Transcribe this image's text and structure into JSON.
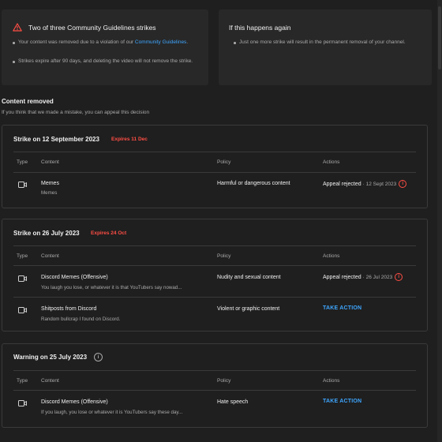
{
  "summary": {
    "title": "Two of three Community Guidelines strikes",
    "bullet1_text": "Your content was removed due to a violation of our",
    "bullet1_link": "Community Guidelines",
    "bullet1_end": ".",
    "bullet2": "Strikes expire after 90 days, and deleting the video will not remove the strike."
  },
  "again": {
    "title": "If this happens again",
    "bullet": "Just one more strike will result in the permanent removal of your channel."
  },
  "section": {
    "title": "Content removed",
    "subtitle": "If you think that we made a mistake, you can appeal this decision"
  },
  "headers": {
    "type": "Type",
    "content": "Content",
    "policy": "Policy",
    "actions": "Actions"
  },
  "strikes": [
    {
      "title": "Strike on 12 September 2023",
      "expires": "Expires 11 Dec",
      "rows": [
        {
          "title": "Memes",
          "desc": "Memes",
          "policy": "Harmful or dangerous content",
          "status": "Appeal rejected",
          "date": "· 12 Sept 2023"
        }
      ]
    },
    {
      "title": "Strike on 26 July 2023",
      "expires": "Expires 24 Oct",
      "rows": [
        {
          "title": "Discord Memes (Offensive)",
          "desc": "You laugh you lose, or whatever it is that YouTubers say nowad...",
          "policy": "Nudity and sexual content",
          "status": "Appeal rejected",
          "date": "· 26 Jul 2023"
        },
        {
          "title": "Shitposts from Discord",
          "desc": "Random bullcrap I found on Discord.",
          "policy": "Violent or graphic content",
          "action": "TAKE ACTION"
        }
      ]
    },
    {
      "title": "Warning on 25 July 2023",
      "rows": [
        {
          "title": "Discord Memes (Offensive)",
          "desc": "If you laugh, you lose or whatever it is YouTubers say these day...",
          "policy": "Hate speech",
          "action": "TAKE ACTION"
        }
      ]
    }
  ],
  "icons": {
    "warning": "warning-triangle-icon",
    "video": "video-camera-icon",
    "info": "info-icon"
  },
  "colors": {
    "accent_link": "#3ea6ff",
    "expiry_red": "#ff4e45",
    "background": "#1f1f1f",
    "card": "#282828"
  }
}
